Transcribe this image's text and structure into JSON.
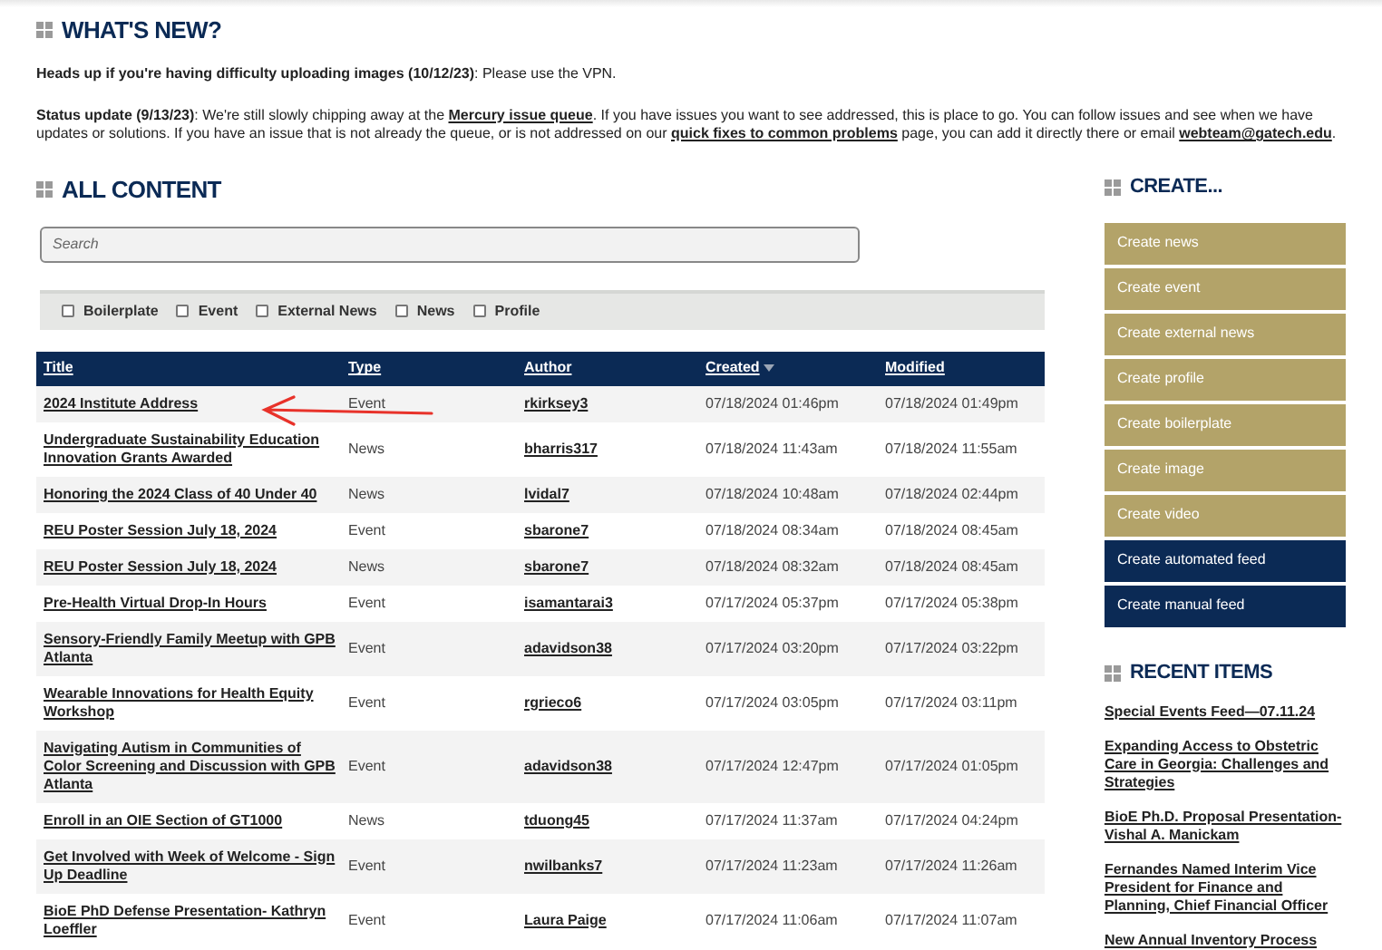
{
  "whats_new": {
    "title": "WHAT'S NEW?",
    "paragraphs": [
      [
        {
          "kind": "bold",
          "text": "Heads up if you're having difficulty uploading images (10/12/23)"
        },
        {
          "kind": "plain",
          "text": ": Please use the VPN."
        }
      ],
      [
        {
          "kind": "bold",
          "text": "Status update (9/13/23)"
        },
        {
          "kind": "plain",
          "text": ": We're still slowly chipping away at the "
        },
        {
          "kind": "link",
          "text": "Mercury issue queue"
        },
        {
          "kind": "plain",
          "text": ". If you have issues you want to see addressed, this is place to go. You can follow issues and see when we have updates or solutions. If you have an issue that is not already the queue, or is not addressed on our "
        },
        {
          "kind": "link",
          "text": "quick fixes to common problems"
        },
        {
          "kind": "plain",
          "text": " page, you can add it directly there or email "
        },
        {
          "kind": "link",
          "text": "webteam@gatech.edu"
        },
        {
          "kind": "plain",
          "text": "."
        }
      ]
    ]
  },
  "all_content": {
    "title": "ALL CONTENT",
    "search": {
      "placeholder": "Search"
    },
    "filters": [
      {
        "label": "Boilerplate",
        "checked": false
      },
      {
        "label": "Event",
        "checked": false
      },
      {
        "label": "External News",
        "checked": false
      },
      {
        "label": "News",
        "checked": false
      },
      {
        "label": "Profile",
        "checked": false
      }
    ],
    "table": {
      "columns": [
        {
          "label": "Title",
          "sorted": false
        },
        {
          "label": "Type",
          "sorted": false
        },
        {
          "label": "Author",
          "sorted": false
        },
        {
          "label": "Created",
          "sorted": true
        },
        {
          "label": "Modified",
          "sorted": false
        }
      ],
      "rows": [
        [
          "2024 Institute Address",
          "Event",
          "rkirksey3",
          "07/18/2024 01:46pm",
          "07/18/2024 01:49pm"
        ],
        [
          "Undergraduate Sustainability Education Innovation Grants Awarded",
          "News",
          "bharris317",
          "07/18/2024 11:43am",
          "07/18/2024 11:55am"
        ],
        [
          "Honoring the 2024 Class of 40 Under 40",
          "News",
          "lvidal7",
          "07/18/2024 10:48am",
          "07/18/2024 02:44pm"
        ],
        [
          "REU Poster Session July 18, 2024",
          "Event",
          "sbarone7",
          "07/18/2024 08:34am",
          "07/18/2024 08:45am"
        ],
        [
          "REU Poster Session July 18, 2024",
          "News",
          "sbarone7",
          "07/18/2024 08:32am",
          "07/18/2024 08:45am"
        ],
        [
          "Pre-Health Virtual Drop-In Hours",
          "Event",
          "isamantarai3",
          "07/17/2024 05:37pm",
          "07/17/2024 05:38pm"
        ],
        [
          "Sensory-Friendly Family Meetup with GPB Atlanta",
          "Event",
          "adavidson38",
          "07/17/2024 03:20pm",
          "07/17/2024 03:22pm"
        ],
        [
          "Wearable Innovations for Health Equity Workshop",
          "Event",
          "rgrieco6",
          "07/17/2024 03:05pm",
          "07/17/2024 03:11pm"
        ],
        [
          "Navigating Autism in Communities of Color Screening and Discussion with GPB Atlanta",
          "Event",
          "adavidson38",
          "07/17/2024 12:47pm",
          "07/17/2024 01:05pm"
        ],
        [
          "Enroll in an OIE Section of GT1000",
          "News",
          "tduong45",
          "07/17/2024 11:37am",
          "07/17/2024 04:24pm"
        ],
        [
          "Get Involved with Week of Welcome - Sign Up Deadline",
          "Event",
          "nwilbanks7",
          "07/17/2024 11:23am",
          "07/17/2024 11:26am"
        ],
        [
          "BioE PhD Defense Presentation- Kathryn Loeffler",
          "Event",
          "Laura Paige",
          "07/17/2024 11:06am",
          "07/17/2024 11:07am"
        ]
      ]
    }
  },
  "create": {
    "title": "CREATE...",
    "buttons": [
      {
        "label": "Create news",
        "kind": "content"
      },
      {
        "label": "Create event",
        "kind": "content"
      },
      {
        "label": "Create external news",
        "kind": "content"
      },
      {
        "label": "Create profile",
        "kind": "content"
      },
      {
        "label": "Create boilerplate",
        "kind": "content"
      },
      {
        "label": "Create image",
        "kind": "content"
      },
      {
        "label": "Create video",
        "kind": "content"
      },
      {
        "label": "Create automated feed",
        "kind": "feed"
      },
      {
        "label": "Create manual feed",
        "kind": "feed"
      }
    ]
  },
  "recent_items": {
    "title": "RECENT ITEMS",
    "items": [
      "Special Events Feed—07.11.24",
      "Expanding Access to Obstetric Care in Georgia: Challenges and Strategies",
      "BioE Ph.D. Proposal Presentation- Vishal A. Manickam",
      "Fernandes Named Interim Vice President for Finance and Planning, Chief Financial Officer",
      "New Annual Inventory Process"
    ]
  }
}
